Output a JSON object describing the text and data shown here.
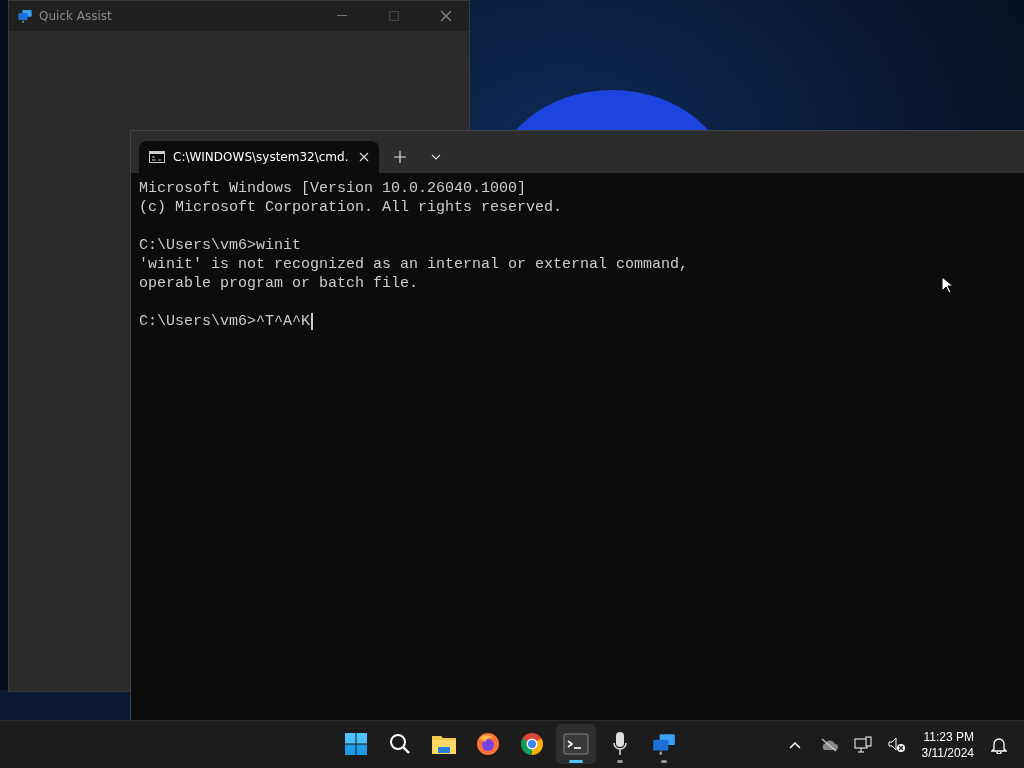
{
  "quick_assist_window": {
    "title": "Quick Assist"
  },
  "terminal_window": {
    "tabs": [
      {
        "title": "C:\\WINDOWS\\system32\\cmd.",
        "selected": true
      }
    ],
    "blocks": [
      [
        "Microsoft Windows [Version 10.0.26040.1000]",
        "(c) Microsoft Corporation. All rights reserved."
      ],
      [
        "C:\\Users\\vm6>winit",
        "'winit' is not recognized as an internal or external command,",
        "operable program or batch file."
      ],
      [
        "C:\\Users\\vm6>^T^A^K"
      ]
    ],
    "cursor_visible": true
  },
  "taskbar": {
    "apps": [
      {
        "kind": "start",
        "running": false,
        "selected": false
      },
      {
        "kind": "search",
        "running": false,
        "selected": false
      },
      {
        "kind": "files",
        "running": false,
        "selected": false
      },
      {
        "kind": "firefox",
        "running": false,
        "selected": false
      },
      {
        "kind": "chrome",
        "running": false,
        "selected": false
      },
      {
        "kind": "terminal",
        "running": true,
        "selected": true
      },
      {
        "kind": "microphone",
        "running": true,
        "selected": false
      },
      {
        "kind": "quickassist",
        "running": true,
        "selected": false
      }
    ],
    "time": "11:23 PM",
    "date": "3/11/2024"
  }
}
